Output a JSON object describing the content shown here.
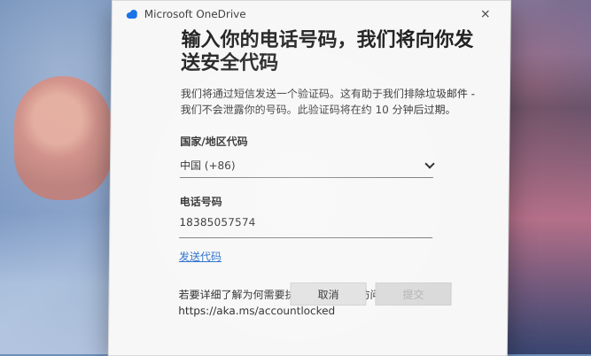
{
  "window": {
    "app_title": "Microsoft OneDrive",
    "close_glyph": "×",
    "icons": {
      "app": "onedrive-cloud-icon",
      "close": "close-icon",
      "dropdown": "chevron-down-icon"
    }
  },
  "dialog": {
    "heading": "输入你的电话号码，我们将向你发送安全代码",
    "description": "我们将通过短信发送一个验证码。这有助于我们排除垃圾邮件 - 我们不会泄露你的号码。此验证码将在约 10 分钟后过期。",
    "country": {
      "label": "国家/地区代码",
      "selected": "中国 (+86)"
    },
    "phone": {
      "label": "电话号码",
      "value": "18385057574"
    },
    "send_code_link": "发送代码",
    "help_text": "若要详细了解为何需要执行此操作，请访问",
    "help_url": "https://aka.ms/accountlocked",
    "buttons": {
      "cancel": "取消",
      "submit": "提交"
    }
  },
  "colors": {
    "link": "#1b66c9",
    "dialog_bg": "#f7f7f7"
  }
}
